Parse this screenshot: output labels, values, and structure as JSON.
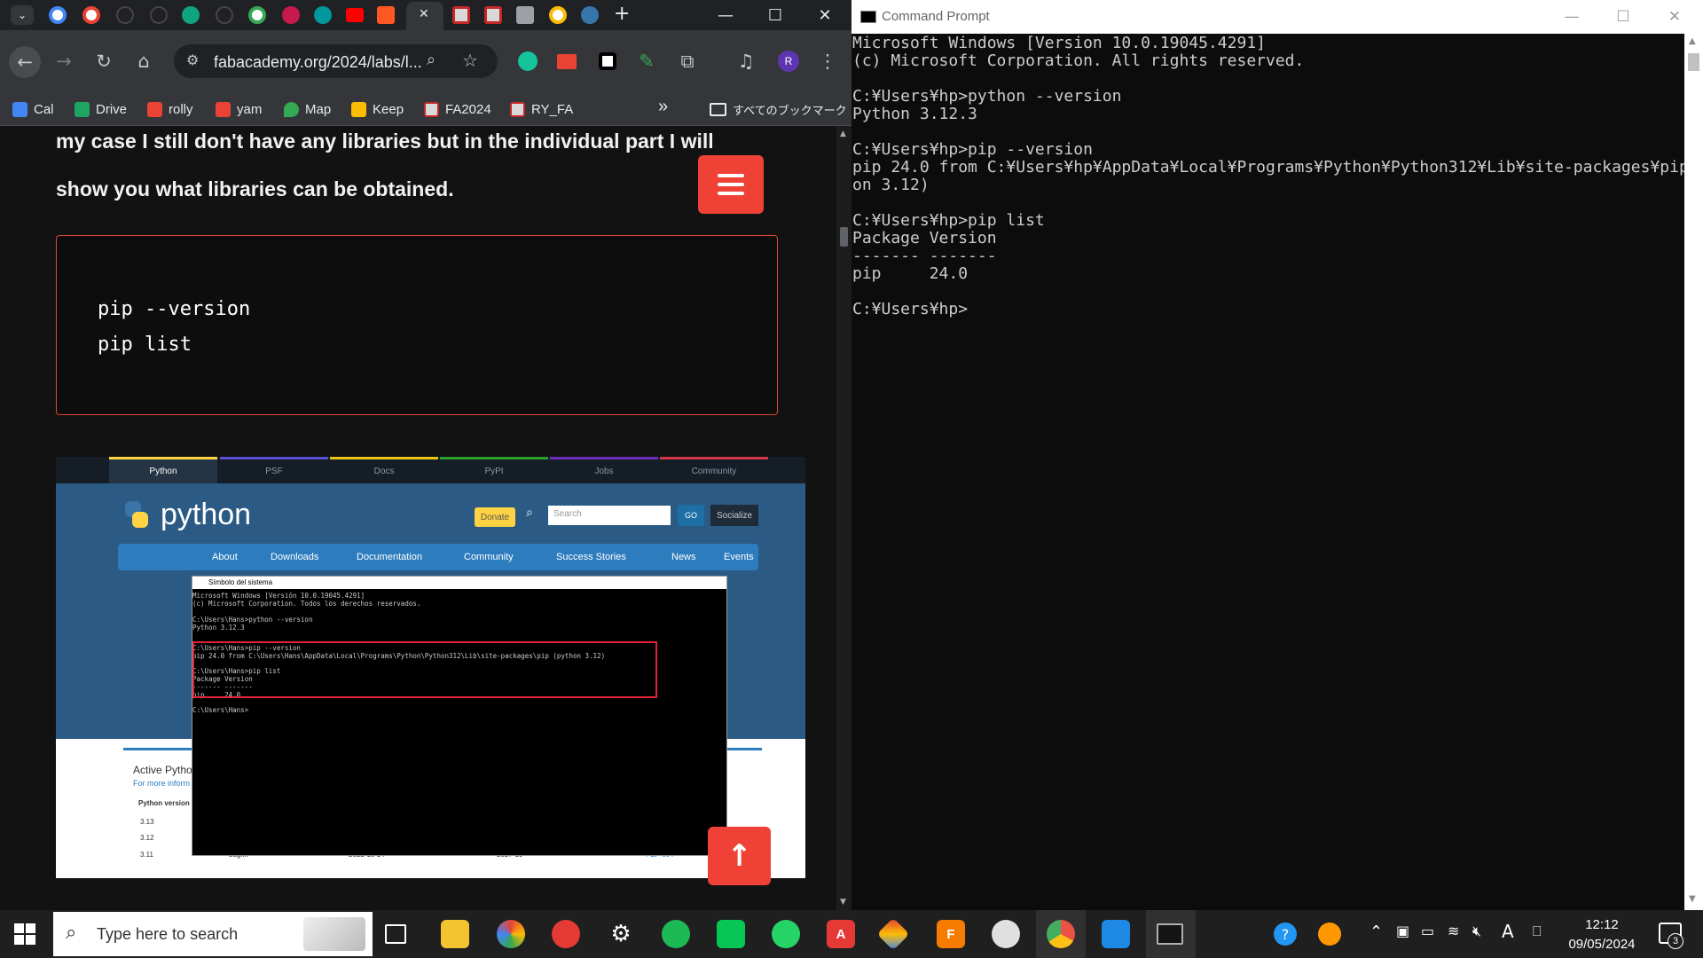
{
  "browser": {
    "url": "fabacademy.org/2024/labs/l...",
    "profile_initial": "R",
    "new_tab_label": "+",
    "close_tab_label": "✕",
    "bookmarks": [
      {
        "label": "Cal",
        "color": "#4285f4"
      },
      {
        "label": "Drive",
        "color": "#1fa463"
      },
      {
        "label": "rolly",
        "color": "#ea4335"
      },
      {
        "label": "yam",
        "color": "#ea4335"
      },
      {
        "label": "Map",
        "color": "#34a853"
      },
      {
        "label": "Keep",
        "color": "#fbbc04"
      },
      {
        "label": "FA2024",
        "color": "#d93025"
      },
      {
        "label": "RY_FA",
        "color": "#d93025"
      }
    ],
    "bookmarks_overflow": "»",
    "all_bookmarks": "すべてのブックマーク"
  },
  "article": {
    "paragraph_line1": "my case I still don't have any libraries but in the individual part I will",
    "paragraph_line2": "show you what libraries can be obtained.",
    "code_lines": [
      "pip --version",
      "pip list"
    ],
    "scroll_top_glyph": "↑"
  },
  "embedded_screenshot": {
    "top_tabs": [
      "Python",
      "PSF",
      "Docs",
      "PyPI",
      "Jobs",
      "Community"
    ],
    "logo_text": "python",
    "donate": "Donate",
    "search_placeholder": "Search",
    "go": "GO",
    "socialize": "Socialize",
    "main_nav": [
      "About",
      "Downloads",
      "Documentation",
      "Community",
      "Success Stories",
      "News",
      "Events"
    ],
    "active_text": "Active Pytho",
    "more_info": "For more inform",
    "python_version_header": "Python version",
    "versions": [
      "3.13",
      "3.12",
      "3.11"
    ],
    "row_status": "bugfix",
    "row_date": "2022-10-24",
    "row_eol": "2027-10",
    "row_pep": "PEP 664",
    "cmd_title": "Símbolo del sistema",
    "cmd_lines": [
      "Microsoft Windows [Versión 10.0.19045.4291]",
      "(c) Microsoft Corporation. Todos los derechos reservados.",
      "",
      "C:\\Users\\Hans>python --version",
      "Python 3.12.3",
      "",
      "C:\\Users\\Hans>pip --version",
      "pip 24.0 from C:\\Users\\Hans\\AppData\\Local\\Programs\\Python\\Python312\\Lib\\site-packages\\pip (python 3.12)",
      "",
      "C:\\Users\\Hans>pip list",
      "Package Version",
      "------- -------",
      "pip     24.0",
      "",
      "C:\\Users\\Hans>"
    ]
  },
  "command_prompt": {
    "title": "Command Prompt",
    "lines": [
      "Microsoft Windows [Version 10.0.19045.4291]",
      "(c) Microsoft Corporation. All rights reserved.",
      "",
      "C:¥Users¥hp>python --version",
      "Python 3.12.3",
      "",
      "C:¥Users¥hp>pip --version",
      "pip 24.0 from C:¥Users¥hp¥AppData¥Local¥Programs¥Python¥Python312¥Lib¥site-packages¥pip (pyth",
      "on 3.12)",
      "",
      "C:¥Users¥hp>pip list",
      "Package Version",
      "------- -------",
      "pip     24.0",
      "",
      "C:¥Users¥hp>"
    ]
  },
  "taskbar": {
    "search_placeholder": "Type here to search",
    "time": "12:12",
    "date": "09/05/2024",
    "notification_count": "3",
    "ime": "A"
  }
}
